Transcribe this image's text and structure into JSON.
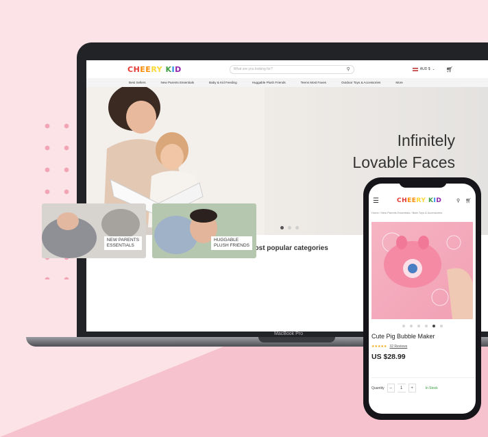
{
  "colors": {
    "background": "#fbe3e7",
    "wedge": "#f6c2cd",
    "accent_green": "#2e9c35"
  },
  "site": {
    "logo_parts": [
      "CH",
      "EE",
      "RY",
      " K",
      "I",
      "D"
    ],
    "search_placeholder": "What are you looking for?",
    "currency": "AUD $",
    "nav": [
      "Best Sellers",
      "New Parents Essentials",
      "Baby & Kid Feeding",
      "Huggable Plush Friends",
      "Teens Most Faves",
      "Outdoor Toys & Accessories",
      "More"
    ],
    "hero": {
      "line1": "Infinitely",
      "line2": "Lovable Faces"
    },
    "section_title": "Most popular categories",
    "categories": [
      {
        "line1": "NEW PARENTS",
        "line2": "ESSENTIALS"
      },
      {
        "line1": "HUGGABLE",
        "line2": "PLUSH FRIENDS"
      }
    ]
  },
  "laptop": {
    "brand": "MacBook Pro"
  },
  "phone": {
    "breadcrumb": "Home  /  New Parents Essentials  /  Bath Toys & Accessories",
    "product_name": "Cute Pig Bubble Maker",
    "stars": "★★★★★",
    "reviews": "32 Reviews",
    "price": "US $28.99",
    "quantity_label": "Quantity",
    "quantity": "1",
    "stock": "In Stock"
  }
}
